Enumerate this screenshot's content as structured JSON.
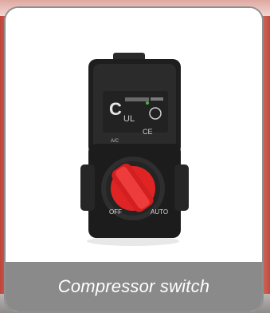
{
  "caption": "Compressor switch",
  "photo": {
    "subject": "pressure switch device",
    "knob_color": "#e02424"
  }
}
